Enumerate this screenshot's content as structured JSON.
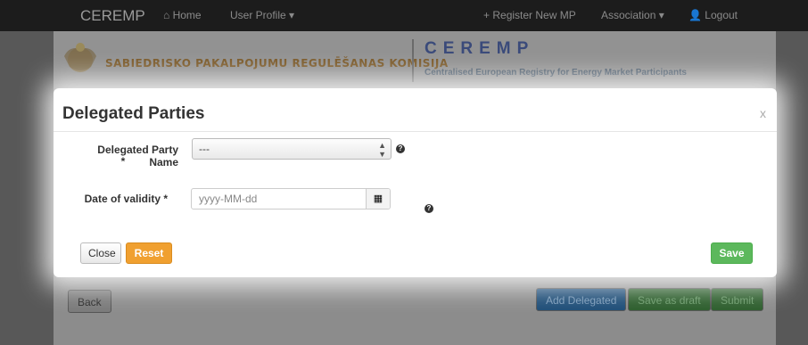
{
  "navbar": {
    "brand": "CEREMP",
    "home": "Home",
    "user_profile": "User Profile",
    "register": "Register New MP",
    "association": "Association",
    "logout": "Logout",
    "home_icon": "home-icon",
    "plus_icon": "plus-icon",
    "user_icon": "user-icon"
  },
  "header": {
    "org_name": "SABIEDRISKO PAKALPOJUMU REGULĒŠANAS KOMISIJA",
    "logo_text": "CEREMP",
    "logo_subtitle": "Centralised European Registry for Energy Market Participants"
  },
  "background_buttons": {
    "back": "Back",
    "add_delegated": "Add Delegated",
    "save_draft": "Save as draft",
    "submit": "Submit"
  },
  "modal": {
    "title": "Delegated Parties",
    "close_symbol": "x",
    "party_label": "Delegated Party Name",
    "party_required": "*",
    "party_value": "---",
    "date_label": "Date of validity *",
    "date_placeholder": "yyyy-MM-dd",
    "help_symbol": "?",
    "close_button": "Close",
    "reset_button": "Reset",
    "save_button": "Save"
  },
  "colors": {
    "save": "#5cb85c",
    "reset": "#f0a030",
    "navbar": "#1c1c1c"
  }
}
